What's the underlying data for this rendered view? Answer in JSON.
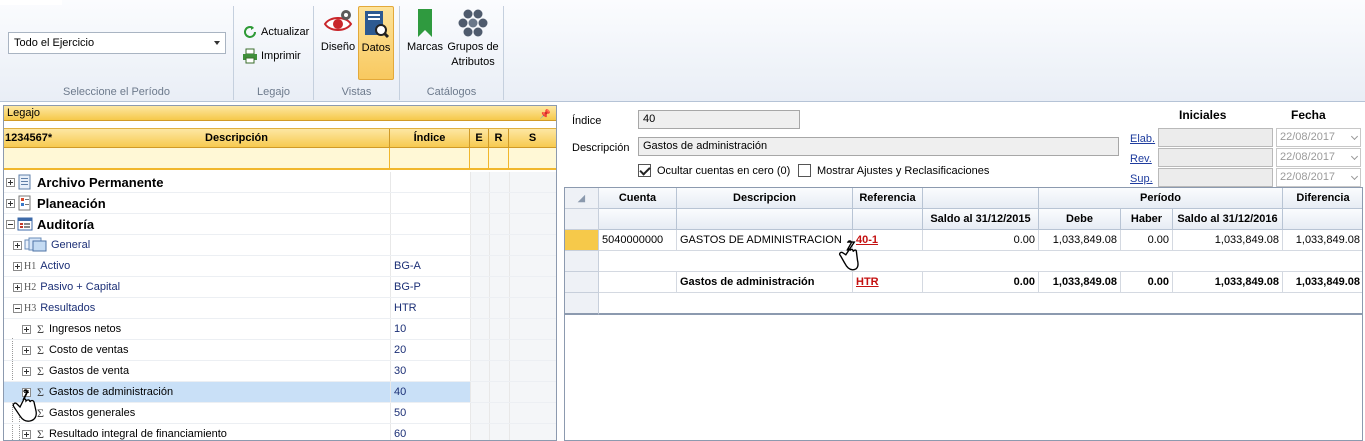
{
  "ribbon": {
    "period_value": "Todo el Ejercicio",
    "period_group_label": "Seleccione el Período",
    "legajo": {
      "actualizar": "Actualizar",
      "imprimir": "Imprimir",
      "group_label": "Legajo"
    },
    "vistas": {
      "diseno": "Diseño",
      "datos": "Datos",
      "group_label": "Vistas"
    },
    "catalogos": {
      "marcas": "Marcas",
      "grupos_1": "Grupos de",
      "grupos_2": "Atributos",
      "group_label": "Catálogos"
    }
  },
  "left": {
    "panel_title": "Legajo",
    "pin": "ᵖ",
    "columns": {
      "levels": "1234567*",
      "descripcion": "Descripción",
      "indice": "Índice",
      "e": "E",
      "r": "R",
      "s": "S"
    },
    "rows": [
      {
        "label": "Archivo Permanente",
        "index": ""
      },
      {
        "label": "Planeación",
        "index": ""
      },
      {
        "label": "Auditoría",
        "index": ""
      },
      {
        "label": "General",
        "index": ""
      },
      {
        "h": "H1",
        "label": "Activo",
        "index": "BG-A"
      },
      {
        "h": "H2",
        "label": "Pasivo + Capital",
        "index": "BG-P"
      },
      {
        "h": "H3",
        "label": "Resultados",
        "index": "HTR"
      },
      {
        "label": "Ingresos netos",
        "index": "10"
      },
      {
        "label": "Costo de ventas",
        "index": "20"
      },
      {
        "label": "Gastos de venta",
        "index": "30"
      },
      {
        "label": "Gastos de administración",
        "index": "40"
      },
      {
        "label": "Gastos generales",
        "index": "50"
      },
      {
        "label": "Resultado integral de financiamiento",
        "index": "60"
      }
    ]
  },
  "right": {
    "indice_label": "Índice",
    "indice_value": "40",
    "descripcion_label": "Descripción",
    "descripcion_value": "Gastos de administración",
    "ocultar_label": "Ocultar cuentas en cero (0)",
    "mostrar_label": "Mostrar Ajustes y Reclasificaciones",
    "iniciales_header": "Iniciales",
    "fecha_header": "Fecha",
    "elab": "Elab.",
    "rev": "Rev.",
    "sup": "Sup.",
    "dates": [
      "22/08/2017",
      "22/08/2017",
      "22/08/2017"
    ],
    "grid": {
      "h_cuenta": "Cuenta",
      "h_descripcion": "Descripcion",
      "h_referencia": "Referencia",
      "h_periodo": "Período",
      "h_diferencia": "Diferencia",
      "h_saldo_ini": "Saldo al 31/12/2015",
      "h_debe": "Debe",
      "h_haber": "Haber",
      "h_saldo_fin": "Saldo al 31/12/2016",
      "row1": {
        "cuenta": "5040000000",
        "desc": "GASTOS DE ADMINISTRACION",
        "ref": "40-1",
        "saldo_ini": "0.00",
        "debe": "1,033,849.08",
        "haber": "0.00",
        "saldo_fin": "1,033,849.08",
        "dif": "1,033,849.08"
      },
      "total": {
        "desc": "Gastos de administración",
        "ref": "HTR",
        "saldo_ini": "0.00",
        "debe": "1,033,849.08",
        "haber": "0.00",
        "saldo_fin": "1,033,849.08",
        "dif": "1,033,849.08"
      }
    }
  }
}
